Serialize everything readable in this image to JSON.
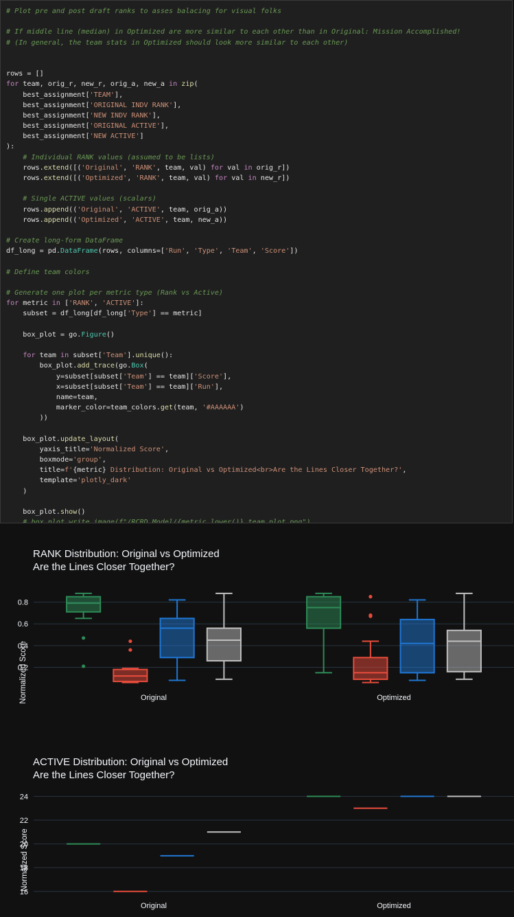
{
  "code_cell": {
    "lines": [
      [
        [
          "cm",
          "# Plot pre and post draft ranks to asses balacing for visual folks"
        ]
      ],
      [],
      [
        [
          "cm",
          "# If middle line (median) in Optimized are more similar to each other than in Original: Mission Accomplished!"
        ]
      ],
      [
        [
          "cm",
          "# (In general, the team stats in Optimized should look more similar to each other)"
        ]
      ],
      [],
      [],
      [
        [
          "tx",
          "rows = []"
        ]
      ],
      [
        [
          "kw",
          "for"
        ],
        [
          "tx",
          " team, orig_r, new_r, orig_a, new_a "
        ],
        [
          "kw",
          "in"
        ],
        [
          "tx",
          " "
        ],
        [
          "fn",
          "zip"
        ],
        [
          "tx",
          "("
        ]
      ],
      [
        [
          "tx",
          "    best_assignment["
        ],
        [
          "st",
          "'TEAM'"
        ],
        [
          "tx",
          "],"
        ]
      ],
      [
        [
          "tx",
          "    best_assignment["
        ],
        [
          "st",
          "'ORIGINAL INDV RANK'"
        ],
        [
          "tx",
          "],"
        ]
      ],
      [
        [
          "tx",
          "    best_assignment["
        ],
        [
          "st",
          "'NEW INDV RANK'"
        ],
        [
          "tx",
          "],"
        ]
      ],
      [
        [
          "tx",
          "    best_assignment["
        ],
        [
          "st",
          "'ORIGINAL ACTIVE'"
        ],
        [
          "tx",
          "],"
        ]
      ],
      [
        [
          "tx",
          "    best_assignment["
        ],
        [
          "st",
          "'NEW ACTIVE'"
        ],
        [
          "tx",
          "]"
        ]
      ],
      [
        [
          "tx",
          "):"
        ]
      ],
      [
        [
          "cm",
          "    # Individual RANK values (assumed to be lists)"
        ]
      ],
      [
        [
          "tx",
          "    rows."
        ],
        [
          "fn",
          "extend"
        ],
        [
          "tx",
          "([("
        ],
        [
          "st",
          "'Original'"
        ],
        [
          "tx",
          ", "
        ],
        [
          "st",
          "'RANK'"
        ],
        [
          "tx",
          ", team, val) "
        ],
        [
          "kw",
          "for"
        ],
        [
          "tx",
          " val "
        ],
        [
          "kw",
          "in"
        ],
        [
          "tx",
          " orig_r])"
        ]
      ],
      [
        [
          "tx",
          "    rows."
        ],
        [
          "fn",
          "extend"
        ],
        [
          "tx",
          "([("
        ],
        [
          "st",
          "'Optimized'"
        ],
        [
          "tx",
          ", "
        ],
        [
          "st",
          "'RANK'"
        ],
        [
          "tx",
          ", team, val) "
        ],
        [
          "kw",
          "for"
        ],
        [
          "tx",
          " val "
        ],
        [
          "kw",
          "in"
        ],
        [
          "tx",
          " new_r])"
        ]
      ],
      [],
      [
        [
          "cm",
          "    # Single ACTIVE values (scalars)"
        ]
      ],
      [
        [
          "tx",
          "    rows."
        ],
        [
          "fn",
          "append"
        ],
        [
          "tx",
          "(("
        ],
        [
          "st",
          "'Original'"
        ],
        [
          "tx",
          ", "
        ],
        [
          "st",
          "'ACTIVE'"
        ],
        [
          "tx",
          ", team, orig_a))"
        ]
      ],
      [
        [
          "tx",
          "    rows."
        ],
        [
          "fn",
          "append"
        ],
        [
          "tx",
          "(("
        ],
        [
          "st",
          "'Optimized'"
        ],
        [
          "tx",
          ", "
        ],
        [
          "st",
          "'ACTIVE'"
        ],
        [
          "tx",
          ", team, new_a))"
        ]
      ],
      [],
      [
        [
          "cm",
          "# Create long-form DataFrame"
        ]
      ],
      [
        [
          "tx",
          "df_long = pd."
        ],
        [
          "bi",
          "DataFrame"
        ],
        [
          "tx",
          "(rows, columns=["
        ],
        [
          "st",
          "'Run'"
        ],
        [
          "tx",
          ", "
        ],
        [
          "st",
          "'Type'"
        ],
        [
          "tx",
          ", "
        ],
        [
          "st",
          "'Team'"
        ],
        [
          "tx",
          ", "
        ],
        [
          "st",
          "'Score'"
        ],
        [
          "tx",
          "])"
        ]
      ],
      [],
      [
        [
          "cm",
          "# Define team colors"
        ]
      ],
      [],
      [
        [
          "cm",
          "# Generate one plot per metric type (Rank vs Active)"
        ]
      ],
      [
        [
          "kw",
          "for"
        ],
        [
          "tx",
          " metric "
        ],
        [
          "kw",
          "in"
        ],
        [
          "tx",
          " ["
        ],
        [
          "st",
          "'RANK'"
        ],
        [
          "tx",
          ", "
        ],
        [
          "st",
          "'ACTIVE'"
        ],
        [
          "tx",
          "]:"
        ]
      ],
      [
        [
          "tx",
          "    subset = df_long[df_long["
        ],
        [
          "st",
          "'Type'"
        ],
        [
          "tx",
          "] == metric]"
        ]
      ],
      [],
      [
        [
          "tx",
          "    box_plot = go."
        ],
        [
          "bi",
          "Figure"
        ],
        [
          "tx",
          "()"
        ]
      ],
      [],
      [
        [
          "tx",
          "    "
        ],
        [
          "kw",
          "for"
        ],
        [
          "tx",
          " team "
        ],
        [
          "kw",
          "in"
        ],
        [
          "tx",
          " subset["
        ],
        [
          "st",
          "'Team'"
        ],
        [
          "tx",
          "]."
        ],
        [
          "fn",
          "unique"
        ],
        [
          "tx",
          "():"
        ]
      ],
      [
        [
          "tx",
          "        box_plot."
        ],
        [
          "fn",
          "add_trace"
        ],
        [
          "tx",
          "(go."
        ],
        [
          "bi",
          "Box"
        ],
        [
          "tx",
          "("
        ]
      ],
      [
        [
          "tx",
          "            y=subset[subset["
        ],
        [
          "st",
          "'Team'"
        ],
        [
          "tx",
          "] == team]["
        ],
        [
          "st",
          "'Score'"
        ],
        [
          "tx",
          "],"
        ]
      ],
      [
        [
          "tx",
          "            x=subset[subset["
        ],
        [
          "st",
          "'Team'"
        ],
        [
          "tx",
          "] == team]["
        ],
        [
          "st",
          "'Run'"
        ],
        [
          "tx",
          "],"
        ]
      ],
      [
        [
          "tx",
          "            name=team,"
        ]
      ],
      [
        [
          "tx",
          "            marker_color=team_colors."
        ],
        [
          "fn",
          "get"
        ],
        [
          "tx",
          "(team, "
        ],
        [
          "st",
          "'#AAAAAA'"
        ],
        [
          "tx",
          ")"
        ]
      ],
      [
        [
          "tx",
          "        ))"
        ]
      ],
      [],
      [
        [
          "tx",
          "    box_plot."
        ],
        [
          "fn",
          "update_layout"
        ],
        [
          "tx",
          "("
        ]
      ],
      [
        [
          "tx",
          "        yaxis_title="
        ],
        [
          "st",
          "'Normalized Score'"
        ],
        [
          "tx",
          ","
        ]
      ],
      [
        [
          "tx",
          "        boxmode="
        ],
        [
          "st",
          "'group'"
        ],
        [
          "tx",
          ","
        ]
      ],
      [
        [
          "tx",
          "        title="
        ],
        [
          "st",
          "f'"
        ],
        [
          "tx",
          "{metric}"
        ],
        [
          "st",
          " Distribution: Original vs Optimized<br>Are the Lines Closer Together?'"
        ],
        [
          "tx",
          ","
        ]
      ],
      [
        [
          "tx",
          "        template="
        ],
        [
          "st",
          "'plotly_dark'"
        ]
      ],
      [
        [
          "tx",
          "    )"
        ]
      ],
      [],
      [
        [
          "tx",
          "    box_plot."
        ],
        [
          "fn",
          "show"
        ],
        [
          "tx",
          "()"
        ]
      ],
      [
        [
          "cm",
          "    # box_plot.write_image(f\"/RCRD_Model/{metric.lower()}_team_plot.png\")"
        ]
      ]
    ]
  },
  "chart_data": [
    {
      "type": "box",
      "title": "RANK Distribution: Original vs Optimized",
      "subtitle": "Are the Lines Closer Together?",
      "ylabel": "Normalized Score",
      "categories": [
        "Original",
        "Optimized"
      ],
      "y_ticks": [
        0.2,
        0.4,
        0.6,
        0.8
      ],
      "ylim": [
        0.02,
        0.93
      ],
      "boxmode": "group",
      "grid": true,
      "series": [
        {
          "color": "#2e8b57",
          "boxes": [
            {
              "q1": 0.71,
              "median": 0.79,
              "q3": 0.85,
              "lower": 0.65,
              "upper": 0.88,
              "outliers": [
                0.47,
                0.21
              ]
            },
            {
              "q1": 0.56,
              "median": 0.75,
              "q3": 0.85,
              "lower": 0.15,
              "upper": 0.88,
              "outliers": []
            }
          ]
        },
        {
          "color": "#e74c3c",
          "boxes": [
            {
              "q1": 0.07,
              "median": 0.12,
              "q3": 0.18,
              "lower": 0.06,
              "upper": 0.19,
              "outliers": [
                0.44,
                0.36
              ]
            },
            {
              "q1": 0.09,
              "median": 0.15,
              "q3": 0.29,
              "lower": 0.06,
              "upper": 0.44,
              "outliers": [
                0.85,
                0.68,
                0.67
              ]
            }
          ]
        },
        {
          "color": "#1f77d4",
          "boxes": [
            {
              "q1": 0.29,
              "median": 0.56,
              "q3": 0.65,
              "lower": 0.08,
              "upper": 0.82,
              "outliers": []
            },
            {
              "q1": 0.15,
              "median": 0.42,
              "q3": 0.64,
              "lower": 0.08,
              "upper": 0.82,
              "outliers": []
            }
          ]
        },
        {
          "color": "#bfbfbf",
          "boxes": [
            {
              "q1": 0.26,
              "median": 0.45,
              "q3": 0.56,
              "lower": 0.09,
              "upper": 0.88,
              "outliers": []
            },
            {
              "q1": 0.16,
              "median": 0.44,
              "q3": 0.54,
              "lower": 0.09,
              "upper": 0.88,
              "outliers": []
            }
          ]
        }
      ]
    },
    {
      "type": "box",
      "title": "ACTIVE Distribution: Original vs Optimized",
      "subtitle": "Are the Lines Closer Together?",
      "ylabel": "Normalized Score",
      "categories": [
        "Original",
        "Optimized"
      ],
      "y_ticks": [
        16,
        18,
        20,
        22,
        24
      ],
      "ylim": [
        15.7,
        24.25
      ],
      "boxmode": "group",
      "grid": true,
      "series": [
        {
          "color": "#2e8b57",
          "values": [
            20,
            24
          ]
        },
        {
          "color": "#e74c3c",
          "values": [
            16,
            23
          ]
        },
        {
          "color": "#1f77d4",
          "values": [
            19,
            24
          ]
        },
        {
          "color": "#bfbfbf",
          "values": [
            21,
            24
          ]
        }
      ]
    }
  ]
}
